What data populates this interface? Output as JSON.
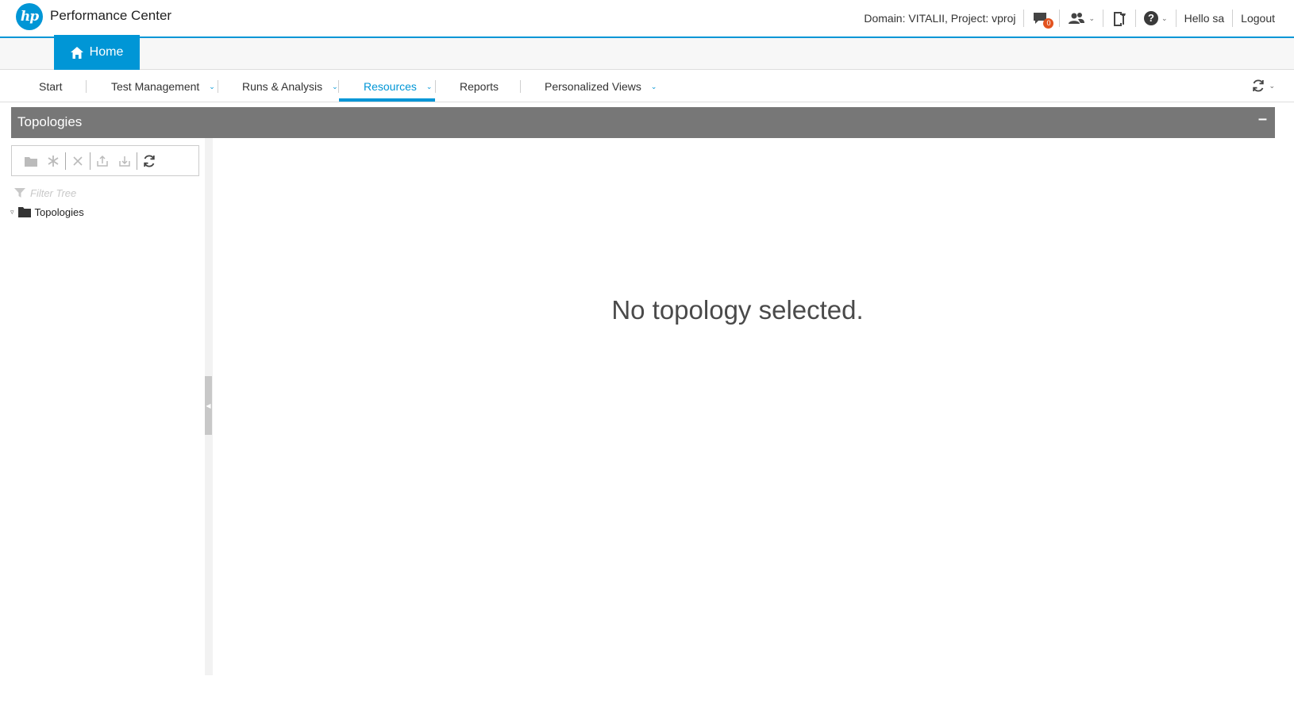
{
  "header": {
    "logo_text": "hp",
    "app_title": "Performance Center",
    "domain_project": "Domain: VITALII,  Project: vproj",
    "messages_badge": "0",
    "messages_icon": "chat-bubble-icon",
    "users_icon": "users-icon",
    "tools_icon": "tools-icon",
    "help_icon": "help-icon",
    "help_glyph": "?",
    "greeting": "Hello  sa",
    "logout": "Logout"
  },
  "tabs": {
    "home_label": "Home",
    "home_icon": "home-icon"
  },
  "nav": {
    "items": [
      {
        "label": "Start",
        "has_dropdown": false
      },
      {
        "label": "Test Management",
        "has_dropdown": true
      },
      {
        "label": "Runs & Analysis",
        "has_dropdown": true
      },
      {
        "label": "Resources",
        "has_dropdown": true,
        "active": true
      },
      {
        "label": "Reports",
        "has_dropdown": false
      },
      {
        "label": "Personalized Views",
        "has_dropdown": true
      }
    ],
    "refresh_icon": "refresh-icon"
  },
  "panel": {
    "title": "Topologies",
    "collapse_glyph": "–"
  },
  "tree": {
    "toolbar": [
      {
        "icon": "new-folder-icon",
        "enabled": false
      },
      {
        "icon": "new-item-icon",
        "enabled": false
      },
      {
        "icon": "delete-icon",
        "enabled": false
      },
      {
        "icon": "upload-icon",
        "enabled": false
      },
      {
        "icon": "download-icon",
        "enabled": false
      },
      {
        "icon": "refresh-icon",
        "enabled": true
      }
    ],
    "filter_placeholder": "Filter Tree",
    "root_node": "Topologies"
  },
  "main": {
    "empty_message": "No topology selected."
  },
  "colors": {
    "accent": "#0096d6",
    "panel_header": "#777777",
    "badge": "#e2531f"
  }
}
